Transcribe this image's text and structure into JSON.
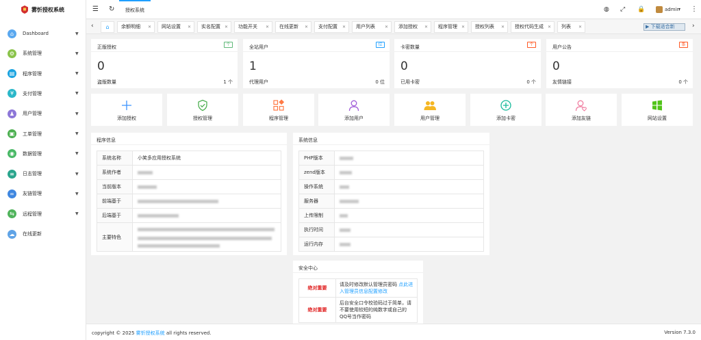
{
  "app": {
    "title": "雾忻授权系统"
  },
  "sidebar": {
    "items": [
      {
        "label": "Dashboard",
        "icon": "dashboard-icon",
        "color": "#5aa8ef",
        "arrow": true
      },
      {
        "label": "系统管理",
        "icon": "settings-icon",
        "color": "#8ac34a",
        "arrow": true
      },
      {
        "label": "程序管理",
        "icon": "program-icon",
        "color": "#1aa3e0",
        "arrow": true
      },
      {
        "label": "支付管理",
        "icon": "payment-icon",
        "color": "#2bb7c9",
        "arrow": true
      },
      {
        "label": "用户管理",
        "icon": "users-icon",
        "color": "#8d77d8",
        "arrow": true
      },
      {
        "label": "工单管理",
        "icon": "ticket-icon",
        "color": "#4caf50",
        "arrow": true
      },
      {
        "label": "数据管理",
        "icon": "database-icon",
        "color": "#48b865",
        "arrow": true
      },
      {
        "label": "日志管理",
        "icon": "log-icon",
        "color": "#2aa58d",
        "arrow": true
      },
      {
        "label": "友链管理",
        "icon": "link-icon",
        "color": "#3f87e0",
        "arrow": true
      },
      {
        "label": "远程管理",
        "icon": "remote-icon",
        "color": "#4fb35b",
        "arrow": true
      },
      {
        "label": "在线更新",
        "icon": "cloud-icon",
        "color": "#5fa3e6",
        "arrow": false
      }
    ]
  },
  "topbar": {
    "title": "授权系统",
    "user": "admin"
  },
  "tabs": [
    "余额明细",
    "网站设置",
    "实名配置",
    "功能开关",
    "在线更新",
    "支付配置",
    "用户列表",
    "添加授权",
    "程序管理",
    "授权列表",
    "授权代码生成",
    "列表"
  ],
  "download_label": "下载适合新",
  "stats": [
    {
      "title": "正版授权",
      "badge": "个",
      "badge_color": "#5fb878",
      "value": "0",
      "foot_label": "盗版数量",
      "foot_value": "1 个"
    },
    {
      "title": "全站用户",
      "badge": "位",
      "badge_color": "#1e9fff",
      "value": "1",
      "foot_label": "代理用户",
      "foot_value": "0 位"
    },
    {
      "title": "卡密数量",
      "badge": "个",
      "badge_color": "#ff5722",
      "value": "0",
      "foot_label": "已用卡密",
      "foot_value": "0 个"
    },
    {
      "title": "用户公告",
      "badge": "条",
      "badge_color": "#ff5722",
      "value": "0",
      "foot_label": "友情链接",
      "foot_value": "0 个"
    }
  ],
  "quick": [
    {
      "label": "添加授权",
      "icon": "plus-icon",
      "color": "#3b93ff"
    },
    {
      "label": "授权管理",
      "icon": "shield-icon",
      "color": "#4caf50"
    },
    {
      "label": "程序管理",
      "icon": "grid-icon",
      "color": "#ff7a45"
    },
    {
      "label": "添加用户",
      "icon": "user-icon",
      "color": "#a05ad8"
    },
    {
      "label": "用户管理",
      "icon": "group-icon",
      "color": "#f5b724"
    },
    {
      "label": "添加卡密",
      "icon": "plus-circle-icon",
      "color": "#17b99a"
    },
    {
      "label": "添加友链",
      "icon": "user-heart-icon",
      "color": "#f07ea1"
    },
    {
      "label": "网站设置",
      "icon": "windows-icon",
      "color": "#52c41a"
    }
  ],
  "program": {
    "title": "程序信息",
    "rows": [
      {
        "k": "系统名称",
        "v": "小笑多应用授权系统"
      },
      {
        "k": "系统作者",
        "v": ""
      },
      {
        "k": "当前版本",
        "v": ""
      },
      {
        "k": "前端基于",
        "v": ""
      },
      {
        "k": "后端基于",
        "v": ""
      },
      {
        "k": "主要特色",
        "v": ""
      }
    ]
  },
  "system": {
    "title": "系统信息",
    "rows": [
      {
        "k": "PHP版本"
      },
      {
        "k": "zend版本"
      },
      {
        "k": "操作系统"
      },
      {
        "k": "服务器"
      },
      {
        "k": "上传限制"
      },
      {
        "k": "执行时间"
      },
      {
        "k": "运行内存"
      }
    ]
  },
  "security": {
    "title": "安全中心",
    "rows": [
      {
        "tag": "绝对重要",
        "text": "请及时修改默认管理员密码 ",
        "link": "点此进入管理员信息配置修改"
      },
      {
        "tag": "绝对重要",
        "text": "后台安全口令校验码过于简单，请不要使用较短的纯数字或自己的QQ号当作密码",
        "link": ""
      }
    ]
  },
  "footer": {
    "copyright_pre": "copyright © 2025 ",
    "brand": "雾忻授权系统",
    "copyright_post": " all rights reserved.",
    "version": "Version 7.3.0"
  }
}
